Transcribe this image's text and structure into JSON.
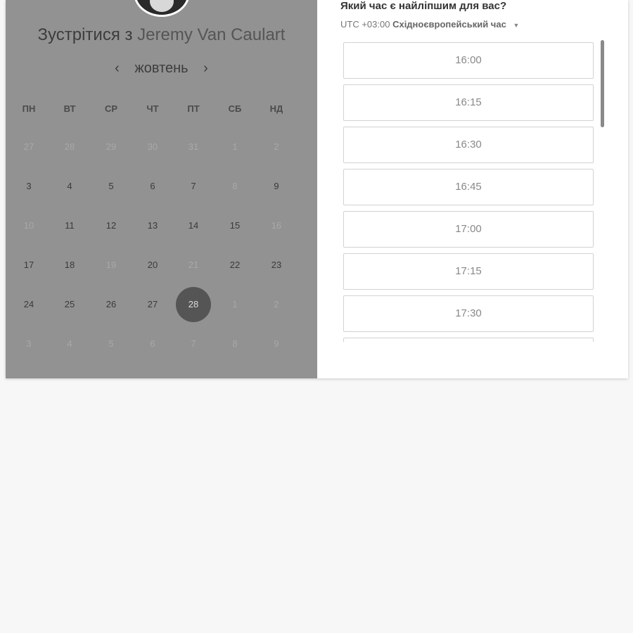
{
  "left": {
    "title_prefix": "Зустрітися з",
    "title_name": "Jeremy Van Caulart",
    "month": "жовтень",
    "prev_arrow": "‹",
    "next_arrow": "›",
    "weekdays": [
      "ПН",
      "ВТ",
      "СР",
      "ЧТ",
      "ПТ",
      "СБ",
      "НД"
    ],
    "weeks": [
      [
        {
          "d": "27",
          "m": true
        },
        {
          "d": "28",
          "m": true
        },
        {
          "d": "29",
          "m": true
        },
        {
          "d": "30",
          "m": true
        },
        {
          "d": "31",
          "m": true
        },
        {
          "d": "1",
          "m": true
        },
        {
          "d": "2",
          "m": true
        }
      ],
      [
        {
          "d": "3",
          "m": false
        },
        {
          "d": "4",
          "m": false
        },
        {
          "d": "5",
          "m": false
        },
        {
          "d": "6",
          "m": false
        },
        {
          "d": "7",
          "m": false
        },
        {
          "d": "8",
          "m": true
        },
        {
          "d": "9",
          "m": false
        }
      ],
      [
        {
          "d": "10",
          "m": true
        },
        {
          "d": "11",
          "m": false
        },
        {
          "d": "12",
          "m": false
        },
        {
          "d": "13",
          "m": false
        },
        {
          "d": "14",
          "m": false
        },
        {
          "d": "15",
          "m": false
        },
        {
          "d": "16",
          "m": true
        }
      ],
      [
        {
          "d": "17",
          "m": false
        },
        {
          "d": "18",
          "m": false
        },
        {
          "d": "19",
          "m": true
        },
        {
          "d": "20",
          "m": false
        },
        {
          "d": "21",
          "m": true
        },
        {
          "d": "22",
          "m": false
        },
        {
          "d": "23",
          "m": false
        }
      ],
      [
        {
          "d": "24",
          "m": false
        },
        {
          "d": "25",
          "m": false
        },
        {
          "d": "26",
          "m": false
        },
        {
          "d": "27",
          "m": false
        },
        {
          "d": "28",
          "m": false,
          "selected": true
        },
        {
          "d": "1",
          "m": true
        },
        {
          "d": "2",
          "m": true
        }
      ],
      [
        {
          "d": "3",
          "m": true
        },
        {
          "d": "4",
          "m": true
        },
        {
          "d": "5",
          "m": true
        },
        {
          "d": "6",
          "m": true
        },
        {
          "d": "7",
          "m": true
        },
        {
          "d": "8",
          "m": true
        },
        {
          "d": "9",
          "m": true
        }
      ]
    ]
  },
  "right": {
    "question": "Який час є найліпшим для вас?",
    "tz_offset": "UTC +03:00",
    "tz_name": "Східноєвропейський час",
    "tz_caret": "▼",
    "slots": [
      "16:00",
      "16:15",
      "16:30",
      "16:45",
      "17:00",
      "17:15",
      "17:30",
      ""
    ]
  }
}
